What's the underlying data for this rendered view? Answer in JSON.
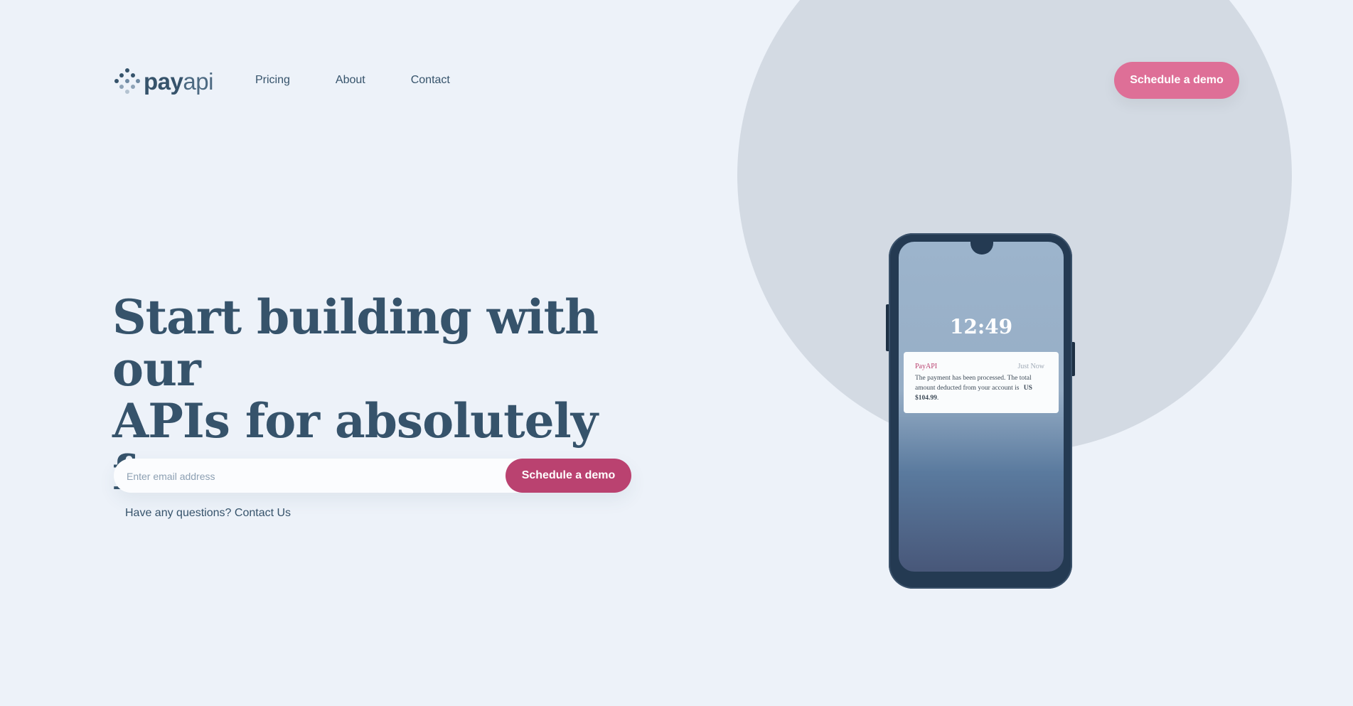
{
  "header": {
    "logo": {
      "bold": "pay",
      "light": "api"
    },
    "nav": [
      {
        "label": "Pricing"
      },
      {
        "label": "About"
      },
      {
        "label": "Contact"
      }
    ],
    "cta_label": "Schedule a demo"
  },
  "hero": {
    "title_line1": "Start building with our",
    "title_line2": "APIs for absolutely",
    "title_line3": "free.",
    "email_placeholder": "Enter email address",
    "submit_label": "Schedule a demo",
    "questions_text": "Have any questions?",
    "contact_link": "Contact Us"
  },
  "phone": {
    "time": "12:49",
    "notification": {
      "app": "PayAPI",
      "time": "Just Now",
      "message": "The payment has been processed. The total amount deducted from your account is",
      "amount": "US $104.99",
      "suffix": "."
    }
  },
  "colors": {
    "background": "#edf2f9",
    "circle": "#d3dae3",
    "primary_text": "#36536b",
    "header_button": "#de6f97",
    "submit_button": "#ba4270",
    "phone_frame": "#243a52"
  },
  "icons": {
    "logo": "payapi-dots-logo-icon"
  }
}
